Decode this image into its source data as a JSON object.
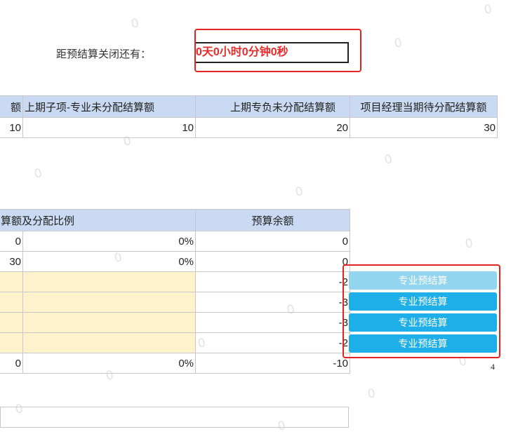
{
  "countdown": {
    "label": "距预结算关闭还有：",
    "value": "0天0小时0分钟0秒"
  },
  "top_table": {
    "headers": [
      "额",
      "上期子项-专业未分配结算额",
      "上期专负未分配结算额",
      "项目经理当期待分配结算额"
    ],
    "row": [
      "10",
      "10",
      "20",
      "30"
    ]
  },
  "middle_table": {
    "headers": [
      "算额及分配比例",
      "预算余额"
    ],
    "rows": [
      [
        "0",
        "0%",
        "0"
      ],
      [
        "30",
        "0%",
        "0"
      ],
      [
        "",
        "",
        "-2"
      ],
      [
        "",
        "",
        "-3"
      ],
      [
        "",
        "",
        "-3"
      ],
      [
        "",
        "",
        "-2"
      ],
      [
        "0",
        "0%",
        "-10"
      ]
    ]
  },
  "buttons": {
    "labels": [
      "专业预结算",
      "专业预结算",
      "专业预结算",
      "专业预结算"
    ]
  },
  "footer_count": "4",
  "watermark_char": "0",
  "colors": {
    "header_bg": "#c9daf2",
    "highlight_bg": "#fff2cc",
    "button_primary": "#1eaee8",
    "button_disabled": "#93d4ef",
    "alert_red": "#e8231f"
  }
}
